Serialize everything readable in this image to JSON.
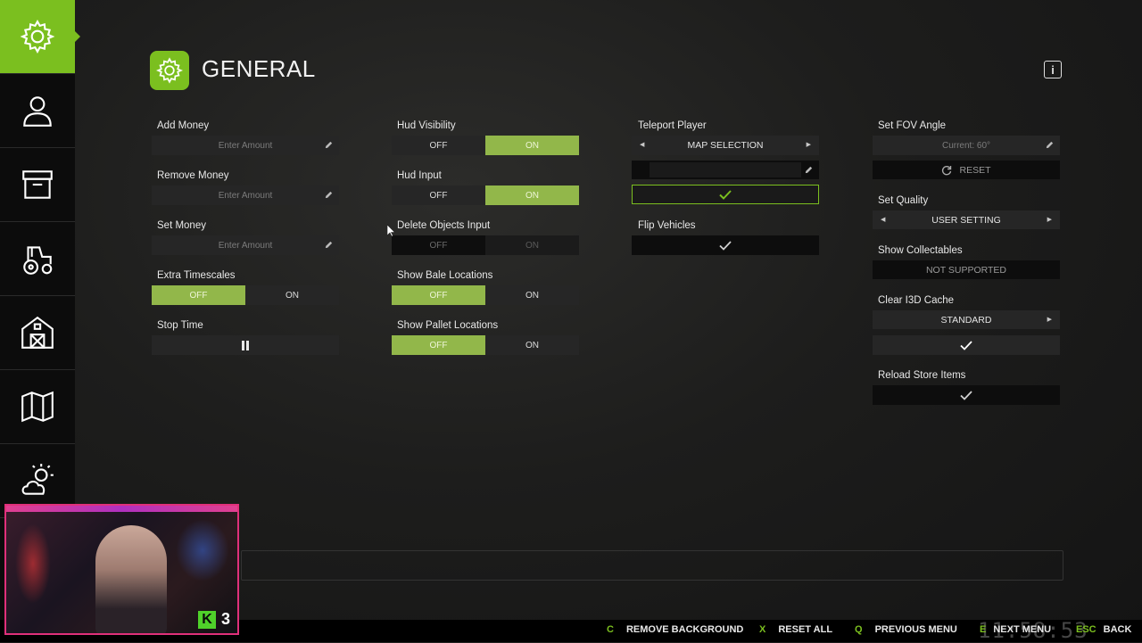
{
  "page": {
    "title": "GENERAL"
  },
  "accent_color": "#7bbf1f",
  "sidebar": {
    "items": [
      {
        "icon": "gear-icon",
        "active": true
      },
      {
        "icon": "user-icon",
        "active": false
      },
      {
        "icon": "archive-box-icon",
        "active": false
      },
      {
        "icon": "tractor-icon",
        "active": false
      },
      {
        "icon": "barn-icon",
        "active": false
      },
      {
        "icon": "map-icon",
        "active": false
      },
      {
        "icon": "weather-icon",
        "active": false
      }
    ]
  },
  "column1": {
    "add_money": {
      "label": "Add Money",
      "placeholder": "Enter Amount"
    },
    "remove_money": {
      "label": "Remove Money",
      "placeholder": "Enter Amount"
    },
    "set_money": {
      "label": "Set Money",
      "placeholder": "Enter Amount"
    },
    "extra_timescales": {
      "label": "Extra Timescales",
      "off": "OFF",
      "on": "ON",
      "selected": "OFF"
    },
    "stop_time": {
      "label": "Stop Time",
      "icon": "pause-icon"
    }
  },
  "column2": {
    "hud_visibility": {
      "label": "Hud Visibility",
      "off": "OFF",
      "on": "ON",
      "selected": "ON"
    },
    "hud_input": {
      "label": "Hud Input",
      "off": "OFF",
      "on": "ON",
      "selected": "ON"
    },
    "delete_objects_input": {
      "label": "Delete Objects Input",
      "off": "OFF",
      "on": "ON",
      "selected": "OFF",
      "disabled": true
    },
    "show_bale_locations": {
      "label": "Show Bale Locations",
      "off": "OFF",
      "on": "ON",
      "selected": "OFF"
    },
    "show_pallet_locations": {
      "label": "Show Pallet Locations",
      "off": "OFF",
      "on": "ON",
      "selected": "OFF"
    }
  },
  "column3": {
    "teleport_player": {
      "label": "Teleport Player",
      "selection": "MAP SELECTION"
    },
    "flip_vehicles": {
      "label": "Flip Vehicles"
    }
  },
  "column4": {
    "set_fov_angle": {
      "label": "Set FOV Angle",
      "placeholder": "Current: 60°",
      "reset": "RESET"
    },
    "set_quality": {
      "label": "Set Quality",
      "selection": "USER SETTING"
    },
    "show_collectables": {
      "label": "Show Collectables",
      "status": "NOT SUPPORTED"
    },
    "clear_i3d_cache": {
      "label": "Clear I3D Cache",
      "selection": "STANDARD"
    },
    "reload_store_items": {
      "label": "Reload Store Items"
    }
  },
  "bottom_bar": {
    "hints": [
      {
        "key": "C",
        "label": "REMOVE BACKGROUND"
      },
      {
        "key": "X",
        "label": "RESET ALL"
      },
      {
        "key": "Q",
        "label": "PREVIOUS MENU"
      },
      {
        "key": "E",
        "label": "NEXT MENU"
      },
      {
        "key": "ESC",
        "label": "BACK"
      }
    ],
    "clock": "11:58:53"
  },
  "webcam": {
    "badge": "K",
    "count": "3"
  }
}
